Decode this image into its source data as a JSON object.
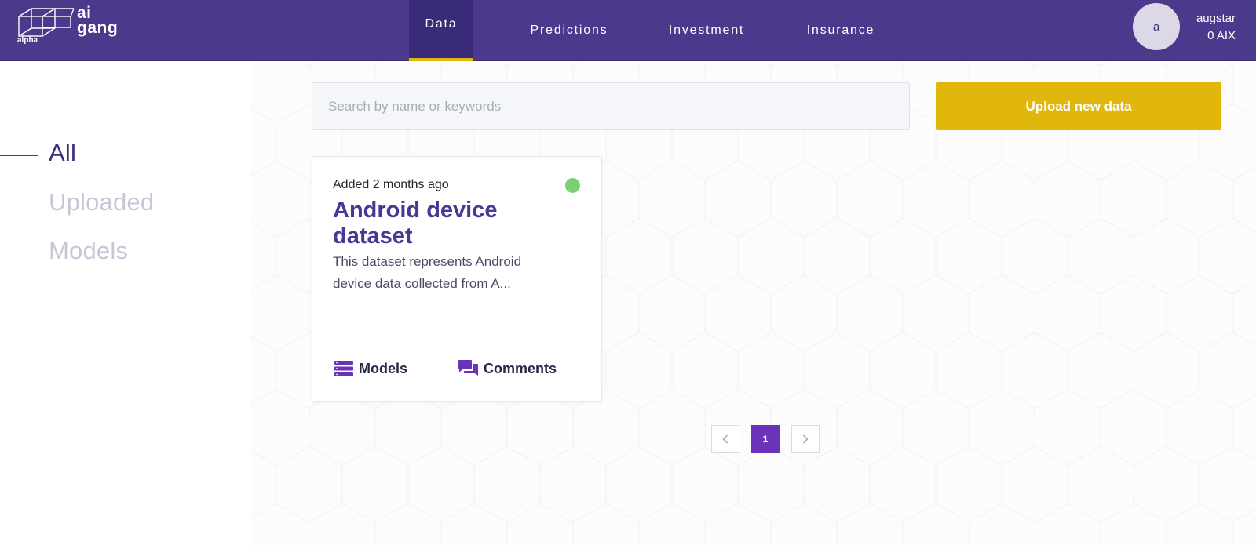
{
  "header": {
    "logo": {
      "line1": "ai",
      "line2": "gang",
      "tag": "alpha"
    },
    "nav": [
      {
        "label": "Data",
        "active": true
      },
      {
        "label": "Predictions",
        "active": false
      },
      {
        "label": "Investment",
        "active": false
      },
      {
        "label": "Insurance",
        "active": false
      }
    ],
    "user": {
      "avatar_letter": "a",
      "name": "augstar",
      "balance": "0 AIX"
    }
  },
  "sidebar": {
    "items": [
      {
        "label": "All",
        "active": true
      },
      {
        "label": "Uploaded",
        "active": false
      },
      {
        "label": "Models",
        "active": false
      }
    ]
  },
  "main": {
    "search": {
      "placeholder": "Search by name or keywords",
      "value": ""
    },
    "upload_label": "Upload new data",
    "cards": [
      {
        "added": "Added 2 months ago",
        "title": "Android device dataset",
        "description": "This dataset represents Android device data collected from A...",
        "status_color": "#7ccf74",
        "actions": [
          {
            "label": "Models",
            "icon": "server-stack-icon"
          },
          {
            "label": "Comments",
            "icon": "comments-icon"
          }
        ]
      }
    ],
    "pagination": {
      "prev": "‹",
      "current": "1",
      "next": "›"
    }
  },
  "colors": {
    "header_bg": "#4b3a8c",
    "accent_yellow": "#e0b70a",
    "primary_purple": "#6b33b8",
    "title_purple": "#4b3596"
  }
}
